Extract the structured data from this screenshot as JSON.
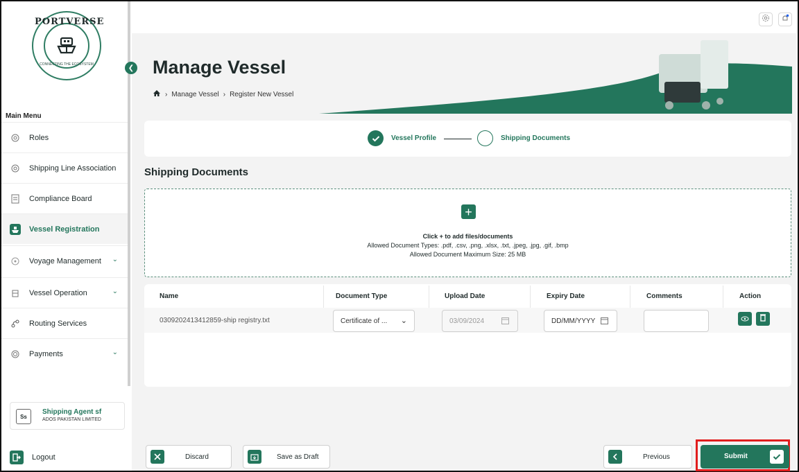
{
  "brand": {
    "logo_text_top": "PORTVERSE",
    "logo_text_bottom": "CONNECTING THE ECOSYSTEM",
    "accent_color": "#23765c"
  },
  "sidebar": {
    "section_label": "Main Menu",
    "items": [
      {
        "label": "Roles",
        "icon": "roles-icon",
        "active": false,
        "has_chevron": false
      },
      {
        "label": "Shipping Line Association",
        "icon": "association-icon",
        "active": false,
        "has_chevron": false
      },
      {
        "label": "Compliance Board",
        "icon": "document-icon",
        "active": false,
        "has_chevron": false
      },
      {
        "label": "Vessel Registration",
        "icon": "ship-icon",
        "active": true,
        "has_chevron": false
      },
      {
        "label": "Voyage Management",
        "icon": "compass-icon",
        "active": false,
        "has_chevron": true
      },
      {
        "label": "Vessel Operation",
        "icon": "vessel-icon",
        "active": false,
        "has_chevron": true
      },
      {
        "label": "Routing Services",
        "icon": "route-icon",
        "active": false,
        "has_chevron": false
      },
      {
        "label": "Payments",
        "icon": "payments-icon",
        "active": false,
        "has_chevron": true
      }
    ],
    "user": {
      "initials": "Ss",
      "name": "Shipping Agent sf",
      "company": "ADOS PAKISTAN LIMITED"
    },
    "logout_label": "Logout"
  },
  "header": {
    "title": "Manage Vessel",
    "breadcrumb": [
      "Manage Vessel",
      "Register New Vessel"
    ]
  },
  "stepper": {
    "steps": [
      {
        "label": "Vessel Profile",
        "status": "completed"
      },
      {
        "label": "Shipping Documents",
        "status": "current"
      }
    ]
  },
  "section": {
    "title": "Shipping Documents"
  },
  "upload": {
    "instruction": "Click + to add files/documents",
    "allowed_types": "Allowed Document Types: .pdf, .csv, .png, .xlsx, .txt, .jpeg, .jpg, .gif, .bmp",
    "max_size": "Allowed Document Maximum Size: 25 MB"
  },
  "table": {
    "columns": [
      "Name",
      "Document Type",
      "Upload Date",
      "Expiry Date",
      "Comments",
      "Action"
    ],
    "rows": [
      {
        "name": "0309202413412859-ship registry.txt",
        "document_type": "Certificate of ...",
        "upload_date": "03/09/2024",
        "expiry_date_placeholder": "DD/MM/YYYY",
        "comments": ""
      }
    ]
  },
  "footer": {
    "discard_label": "Discard",
    "draft_label": "Save as Draft",
    "previous_label": "Previous",
    "submit_label": "Submit"
  }
}
